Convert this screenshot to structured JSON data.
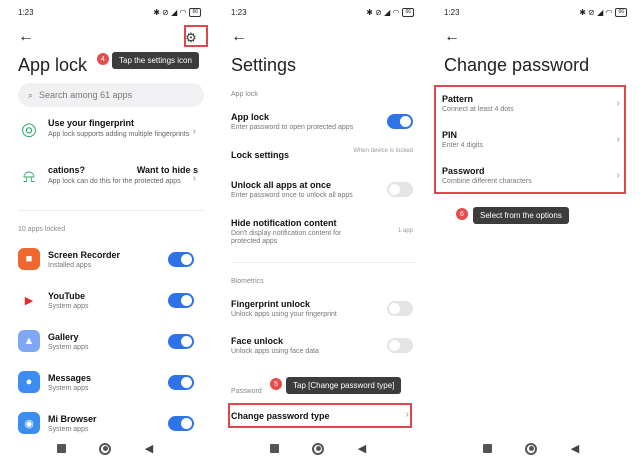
{
  "status": {
    "time": "1:23",
    "battery": "66"
  },
  "panel1": {
    "title": "App lock",
    "search_placeholder": "Search among 61 apps",
    "fingerprint": {
      "title": "Use your fingerprint",
      "subtitle": "App lock supports adding multiple fingerprints"
    },
    "notif": {
      "title_left": "cations?",
      "title_right": "Want to hide s",
      "subtitle": "App lock can do this for the protected apps"
    },
    "locked_count": "10 apps locked",
    "apps": [
      {
        "name": "Screen Recorder",
        "sub": "Installed apps",
        "color": "#f0672f",
        "glyph": "■",
        "on": true
      },
      {
        "name": "YouTube",
        "sub": "System apps",
        "color": "#ffffff",
        "glyph": "▶",
        "on": true
      },
      {
        "name": "Gallery",
        "sub": "System apps",
        "color": "#7fa7f3",
        "glyph": "▲",
        "on": true
      },
      {
        "name": "Messages",
        "sub": "System apps",
        "color": "#3d8cf2",
        "glyph": "●",
        "on": true
      },
      {
        "name": "Mi Browser",
        "sub": "System apps",
        "color": "#3b8ef0",
        "glyph": "◉",
        "on": true
      }
    ],
    "tooltip": "Tap the settings icon",
    "step": "4"
  },
  "panel2": {
    "title": "Settings",
    "section_applock": "App lock",
    "app_lock": {
      "title": "App lock",
      "sub": "Enter password to open protected apps"
    },
    "lock_settings": {
      "title": "Lock settings",
      "value": "When device is locked"
    },
    "unlock_all": {
      "title": "Unlock all apps at once",
      "sub": "Enter password once to unlock all apps"
    },
    "hide_notif": {
      "title": "Hide notification content",
      "sub": "Don't display notification content for protected apps",
      "value": "1 app"
    },
    "section_bio": "Biometrics",
    "fingerprint": {
      "title": "Fingerprint unlock",
      "sub": "Unlock apps using your fingerprint"
    },
    "face": {
      "title": "Face unlock",
      "sub": "Unlock apps using face data"
    },
    "section_pw": "Password",
    "change_pw": {
      "title": "Change password type"
    },
    "tooltip": "Tap [Change password type]",
    "step": "5"
  },
  "panel3": {
    "title": "Change password",
    "options": [
      {
        "title": "Pattern",
        "sub": "Connect at least 4 dots"
      },
      {
        "title": "PIN",
        "sub": "Enter 4 digits"
      },
      {
        "title": "Password",
        "sub": "Combine different characters"
      }
    ],
    "tooltip": "Select from the options",
    "step": "6"
  },
  "colors": {
    "accent": "#2f73e8",
    "highlight": "#e0474c",
    "tooltip_bg": "#3c3c3c"
  }
}
